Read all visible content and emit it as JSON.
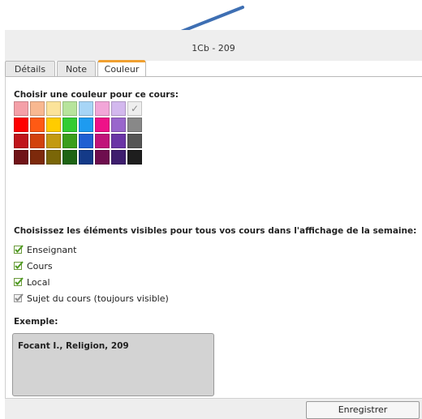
{
  "window": {
    "title": "1Cb - 209"
  },
  "tabs": [
    {
      "label": "Détails",
      "active": false
    },
    {
      "label": "Note",
      "active": false
    },
    {
      "label": "Couleur",
      "active": true
    }
  ],
  "colour_section": {
    "heading": "Choisir une couleur pour ce cours:",
    "palette": [
      [
        "#f4a0a8",
        "#f8b890",
        "#fbe39a",
        "#b7e49c",
        "#a7d5f6",
        "#f2a6d8",
        "#d3b8ee",
        "#eeeeee"
      ],
      [
        "#ff0000",
        "#ff5a14",
        "#ffcc00",
        "#33cc33",
        "#1e9bf0",
        "#ee1188",
        "#9966cc",
        "#888888"
      ],
      [
        "#c0161c",
        "#d2420c",
        "#c39a10",
        "#3a9e1c",
        "#1f5fd2",
        "#c0147a",
        "#6a35a6",
        "#555555"
      ],
      [
        "#701418",
        "#7d2a0c",
        "#7a6608",
        "#1e6414",
        "#143a88",
        "#6e0e4e",
        "#3e1e6e",
        "#1e1e1e"
      ]
    ],
    "selected_swatch": "light-grey"
  },
  "visibility_section": {
    "heading": "Choisissez les éléments visibles pour tous vos cours dans l'affichage de la semaine:",
    "options": [
      {
        "label": "Enseignant",
        "checked": true,
        "disabled": false
      },
      {
        "label": "Cours",
        "checked": true,
        "disabled": false
      },
      {
        "label": "Local",
        "checked": true,
        "disabled": false
      },
      {
        "label": "Sujet du cours (toujours visible)",
        "checked": true,
        "disabled": true
      }
    ]
  },
  "example_section": {
    "heading": "Exemple:",
    "preview_text": "Focant I., Religion, 209"
  },
  "footer": {
    "save_label": "Enregistrer"
  },
  "colors": {
    "accent_tab": "#f0a030",
    "arrow": "#3e6fb3",
    "check_green": "#5aa02c"
  }
}
